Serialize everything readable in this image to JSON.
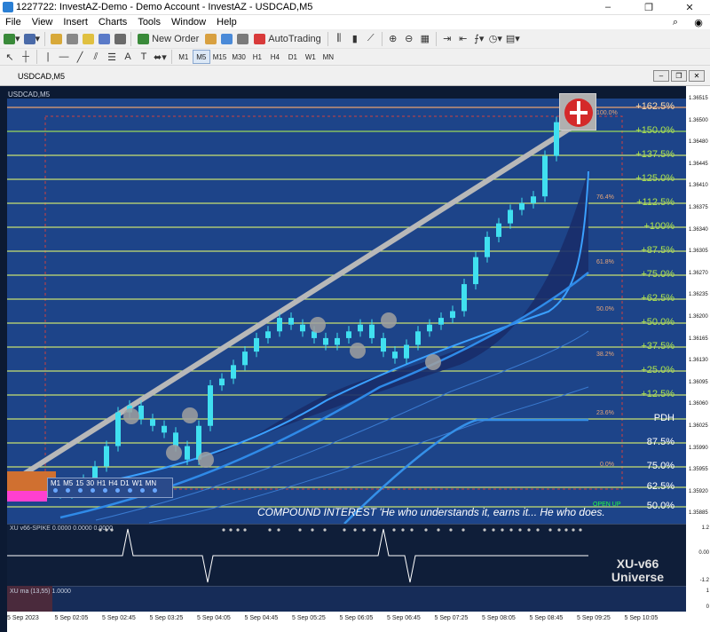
{
  "window": {
    "title": "1227722: InvestAZ-Demo - Demo Account - InvestAZ - USDCAD,M5",
    "min": "–",
    "restore": "❐",
    "close": "✕"
  },
  "menu": [
    "File",
    "View",
    "Insert",
    "Charts",
    "Tools",
    "Window",
    "Help"
  ],
  "toolbar": {
    "new_order": "New Order",
    "auto_trading": "AutoTrading"
  },
  "timeframes": [
    "M1",
    "M5",
    "M15",
    "M30",
    "H1",
    "H4",
    "D1",
    "W1",
    "MN"
  ],
  "active_timeframe": "M5",
  "tab": {
    "label": "USDCAD,M5"
  },
  "chart": {
    "symbol_label": "USDCAD,M5",
    "price_ticks": [
      "1.36515",
      "1.36500",
      "1.36480",
      "1.36445",
      "1.36410",
      "1.36375",
      "1.36340",
      "1.36305",
      "1.36270",
      "1.36235",
      "1.36200",
      "1.36165",
      "1.36130",
      "1.36095",
      "1.36060",
      "1.36025",
      "1.35990",
      "1.35955",
      "1.35920",
      "1.35885"
    ],
    "fib_ext": [
      "+162.5%",
      "+150.0%",
      "+137.5%",
      "+125.0%",
      "+112.5%",
      "+100%",
      "+87.5%",
      "+75.0%",
      "+62.5%",
      "+50.0%",
      "+37.5%",
      "+25.0%",
      "+12.5%",
      "PDH",
      "87.5%",
      "75.0%",
      "62.5%",
      "50.0%"
    ],
    "retracements": [
      "100.0%",
      "76.4%",
      "61.8%",
      "50.0%",
      "38.2%",
      "23.6%",
      "0.0%"
    ],
    "tf_panel_labels": [
      "M1",
      "M5",
      "15",
      "30",
      "H1",
      "H4",
      "D1",
      "W1",
      "MN"
    ],
    "ticker": "COMPOUND INTEREST 'He who understands it, earns it... He who does.",
    "open_up": "OPEN UP"
  },
  "indicator1": {
    "label": "XU v66-SPIKE 0.0000 0.0000 0.0000",
    "brand_line1": "XU-v66",
    "brand_line2": "Universe",
    "scale": [
      "1.2",
      "0.00",
      "-1.2"
    ]
  },
  "indicator2": {
    "label": "XU ma (13,55) 1.0000",
    "scale": [
      "1",
      "0"
    ]
  },
  "time_ticks": [
    "5 Sep 2023",
    "5 Sep 02:05",
    "5 Sep 02:45",
    "5 Sep 03:25",
    "5 Sep 04:05",
    "5 Sep 04:45",
    "5 Sep 05:25",
    "5 Sep 06:05",
    "5 Sep 06:45",
    "5 Sep 07:25",
    "5 Sep 08:05",
    "5 Sep 08:45",
    "5 Sep 09:25",
    "5 Sep 10:05"
  ],
  "chart_data": {
    "type": "candlestick",
    "symbol": "USDCAD",
    "timeframe": "M5",
    "ylim": [
      1.35885,
      1.36515
    ],
    "close_approx": [
      1.3593,
      1.3594,
      1.3595,
      1.3597,
      1.36,
      1.3605,
      1.3606,
      1.3604,
      1.3603,
      1.3602,
      1.36,
      1.3598,
      1.3603,
      1.3609,
      1.361,
      1.3612,
      1.3614,
      1.3616,
      1.3617,
      1.3619,
      1.3618,
      1.3617,
      1.3616,
      1.3615,
      1.3616,
      1.3617,
      1.3618,
      1.3616,
      1.3614,
      1.3613,
      1.3615,
      1.3617,
      1.3618,
      1.3619,
      1.362,
      1.3624,
      1.3628,
      1.3631,
      1.3633,
      1.3635,
      1.3636,
      1.3637,
      1.3643,
      1.3648,
      1.3649
    ]
  }
}
